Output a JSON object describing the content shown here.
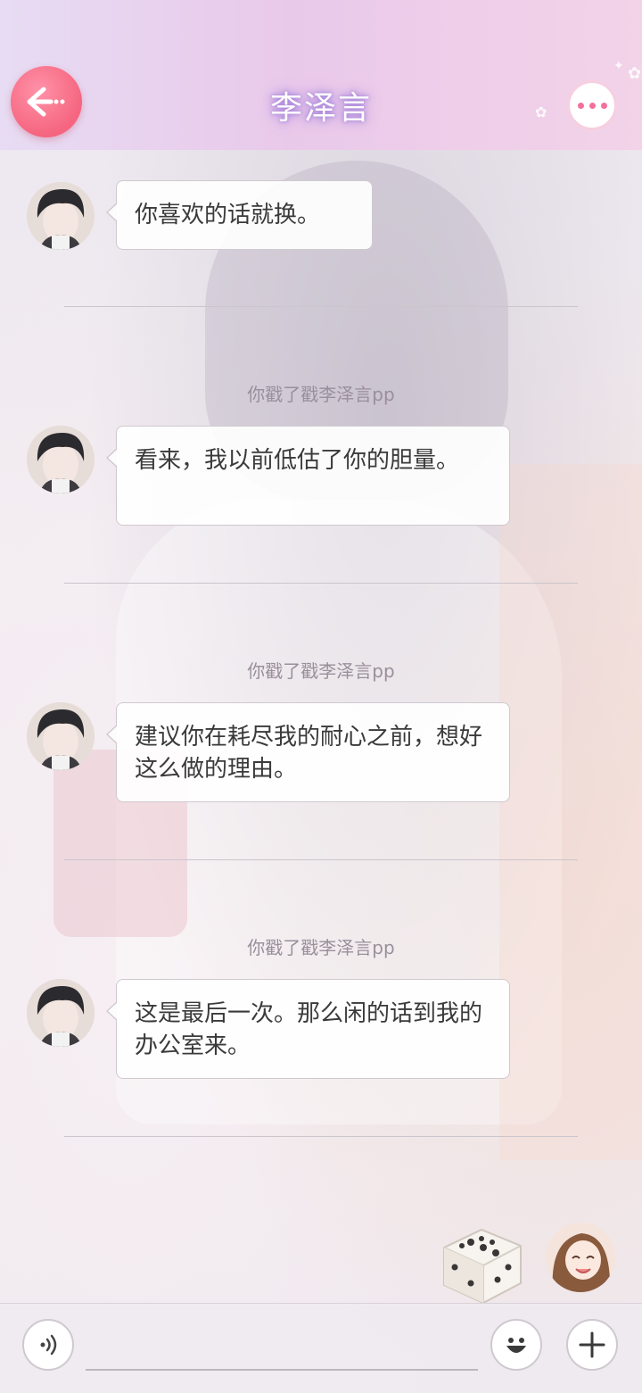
{
  "header": {
    "title": "李泽言",
    "back_icon": "back-arrow-icon",
    "more_icon": "more-dots-icon"
  },
  "messages": [
    {
      "sender": "李泽言",
      "text": "你喜欢的话就换。"
    },
    {
      "sender": "李泽言",
      "text": "看来，我以前低估了你的胆量。"
    },
    {
      "sender": "李泽言",
      "text": "建议你在耗尽我的耐心之前，想好这么做的理由。"
    },
    {
      "sender": "李泽言",
      "text": "这是最后一次。那么闲的话到我的办公室来。"
    }
  ],
  "system_notes": [
    "你戳了戳李泽言pp",
    "你戳了戳李泽言pp",
    "你戳了戳李泽言pp"
  ],
  "bottom": {
    "voice_icon": "voice-input-icon",
    "emoji_icon": "emoji-icon",
    "plus_icon": "plus-icon",
    "dice_icon": "dice-icon"
  },
  "colors": {
    "accent_pink": "#f5657f",
    "title_glow": "#a57fd8"
  }
}
